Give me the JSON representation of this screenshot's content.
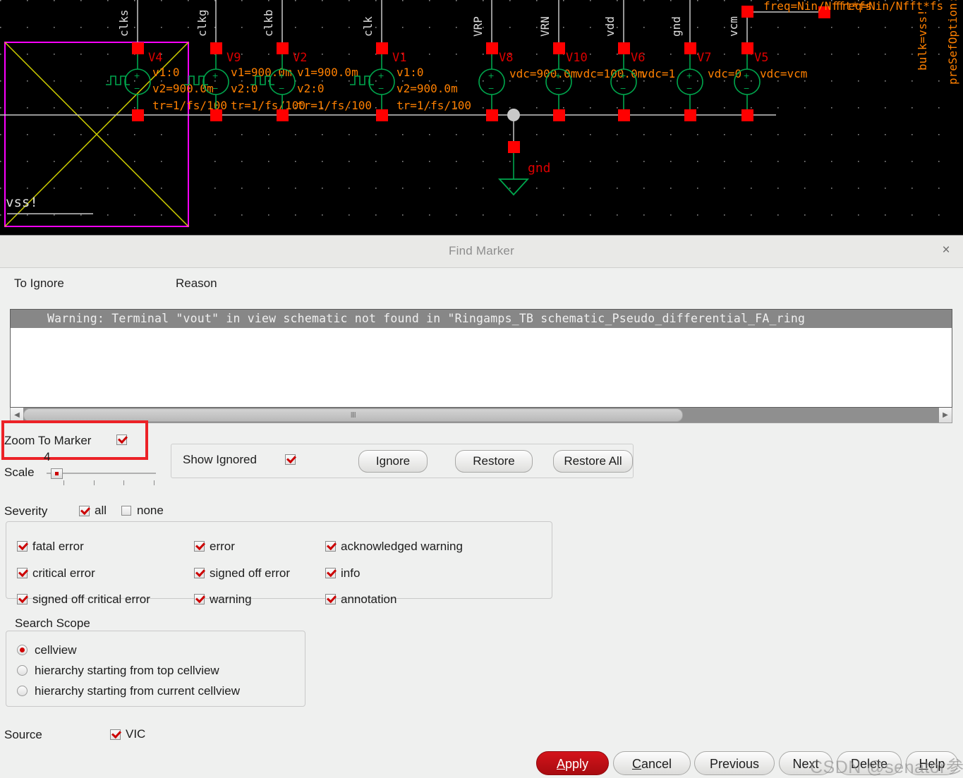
{
  "schematic": {
    "background_color": "#000000",
    "selection_box_color": "#ff00ff",
    "pin_color": "#ff0000",
    "source_color": "#00a64d",
    "param_text_color": "#ff8000",
    "instance_label_color": "#dd0000",
    "wire_color": "#c8c8c8",
    "net_label_color": "#dcdcdc",
    "vss_label": "vss!",
    "gnd_label": "gnd",
    "nets": [
      "clks",
      "clkg",
      "clkb",
      "clk",
      "VRP",
      "VRN",
      "vdd",
      "gnd",
      "vcm"
    ],
    "sources": [
      {
        "name": "V4",
        "params": [
          "v1:0",
          "v2=900.0m",
          "tr=1/fs/100"
        ]
      },
      {
        "name": "V9",
        "params": [
          "v1=900.0m",
          "v2:0",
          "tr=1/fs/100"
        ]
      },
      {
        "name": "V2",
        "params": [
          "v1=900.0m",
          "v2:0",
          "tr=1/fs/100"
        ]
      },
      {
        "name": "V1",
        "params": [
          "v1:0",
          "v2=900.0m",
          "tr=1/fs/100"
        ]
      },
      {
        "name": "V8",
        "params": [
          "vdc=900.0m"
        ]
      },
      {
        "name": "V10",
        "params": [
          "vdc=100.0m"
        ]
      },
      {
        "name": "V6",
        "params": [
          "vdc=1"
        ]
      },
      {
        "name": "V7",
        "params": [
          "vdc=0"
        ]
      },
      {
        "name": "V5",
        "params": [
          "vdc=vcm"
        ]
      }
    ],
    "annotations": [
      "freq=Nin/Nfft*fs",
      "freq=Nin/Nfft*fs",
      "bulk=vss!",
      "preSefOption:Custom"
    ]
  },
  "dialog": {
    "title": "Find Marker",
    "close_label": "×",
    "columns": {
      "to_ignore": "To Ignore",
      "reason": "Reason"
    },
    "messages": [
      "Warning: Terminal \"vout\" in view schematic not found in \"Ringamps_TB schematic_Pseudo_differential_FA_ring"
    ],
    "scrollbar": {
      "left_arrow": "◀",
      "right_arrow": "▶",
      "grip": "‖‖"
    },
    "zoom_to_marker": {
      "label": "Zoom To Marker",
      "checked": true
    },
    "scale": {
      "label": "Scale",
      "value": "4",
      "tick_count": 4
    },
    "show_ignored": {
      "label": "Show Ignored",
      "checked": true
    },
    "ignore_button": "Ignore",
    "restore_button": "Restore",
    "restore_all_button": "Restore All",
    "severity": {
      "label": "Severity",
      "all": {
        "label": "all",
        "checked": true
      },
      "none": {
        "label": "none",
        "checked": false
      },
      "items": [
        {
          "label": "fatal error",
          "checked": true
        },
        {
          "label": "critical error",
          "checked": true
        },
        {
          "label": "signed off critical error",
          "checked": true
        },
        {
          "label": "error",
          "checked": true
        },
        {
          "label": "signed off error",
          "checked": true
        },
        {
          "label": "warning",
          "checked": true
        },
        {
          "label": "acknowledged warning",
          "checked": true
        },
        {
          "label": "info",
          "checked": true
        },
        {
          "label": "annotation",
          "checked": true
        }
      ]
    },
    "search_scope": {
      "label": "Search Scope",
      "options": [
        {
          "label": "cellview",
          "selected": true
        },
        {
          "label": "hierarchy starting from top cellview",
          "selected": false
        },
        {
          "label": "hierarchy starting from current cellview",
          "selected": false
        }
      ]
    },
    "source": {
      "label": "Source",
      "value": "VIC",
      "checked": true
    },
    "footer_buttons": [
      {
        "label": "Apply",
        "accel": "A",
        "primary": true
      },
      {
        "label": "Cancel",
        "accel": "C",
        "primary": false
      },
      {
        "label": "Previous",
        "accel": "",
        "primary": false
      },
      {
        "label": "Next",
        "accel": "",
        "primary": false
      },
      {
        "label": "Delete",
        "accel": "",
        "primary": false
      },
      {
        "label": "Help",
        "accel": "H",
        "primary": false
      }
    ],
    "accent_color": "#cc0000",
    "annotation_box_color": "#ec2227"
  },
  "watermark": "CSDN @senator参议员"
}
